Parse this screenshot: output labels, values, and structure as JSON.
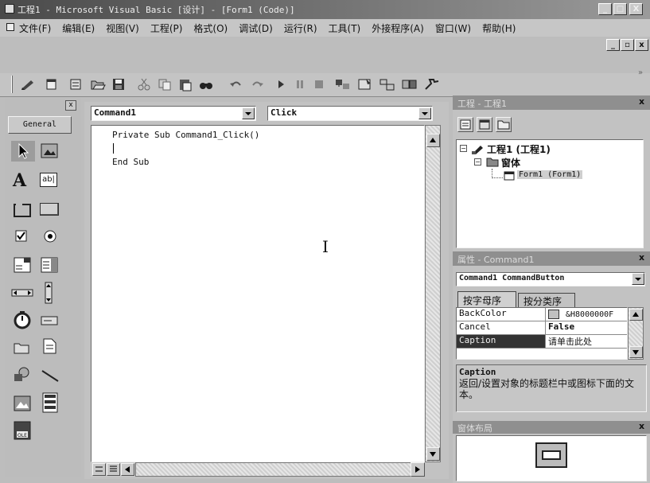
{
  "titlebar": {
    "title": "工程1 - Microsoft Visual Basic [设计] - [Form1 (Code)]",
    "min_label": "_",
    "max_label": "□",
    "close_label": "X"
  },
  "menu": {
    "items": [
      "文件(F)",
      "编辑(E)",
      "视图(V)",
      "工程(P)",
      "格式(O)",
      "调试(D)",
      "运行(R)",
      "工具(T)",
      "外接程序(A)",
      "窗口(W)",
      "帮助(H)"
    ]
  },
  "toolbox": {
    "close_label": "x",
    "tab_label": "General"
  },
  "code_window": {
    "object_combo": "Command1",
    "proc_combo": "Click",
    "lines": [
      "Private Sub Command1_Click()",
      "",
      "End Sub"
    ]
  },
  "project_explorer": {
    "title": "工程 - 工程1",
    "tree": {
      "project": "工程1 (工程1)",
      "folder": "窗体",
      "form": "Form1 (Form1)"
    }
  },
  "properties": {
    "title": "属性 - Command1",
    "object_combo": "Command1 CommandButton",
    "tab_alpha": "按字母序",
    "tab_category": "按分类序",
    "rows": [
      {
        "name": "BackColor",
        "value": "&H8000000F"
      },
      {
        "name": "Cancel",
        "value": "False"
      },
      {
        "name": "Caption",
        "value": "请单击此处"
      }
    ],
    "desc_title": "Caption",
    "desc_text": "返回/设置对象的标题栏中或图标下面的文本。"
  },
  "form_layout": {
    "title": "窗体布局"
  }
}
